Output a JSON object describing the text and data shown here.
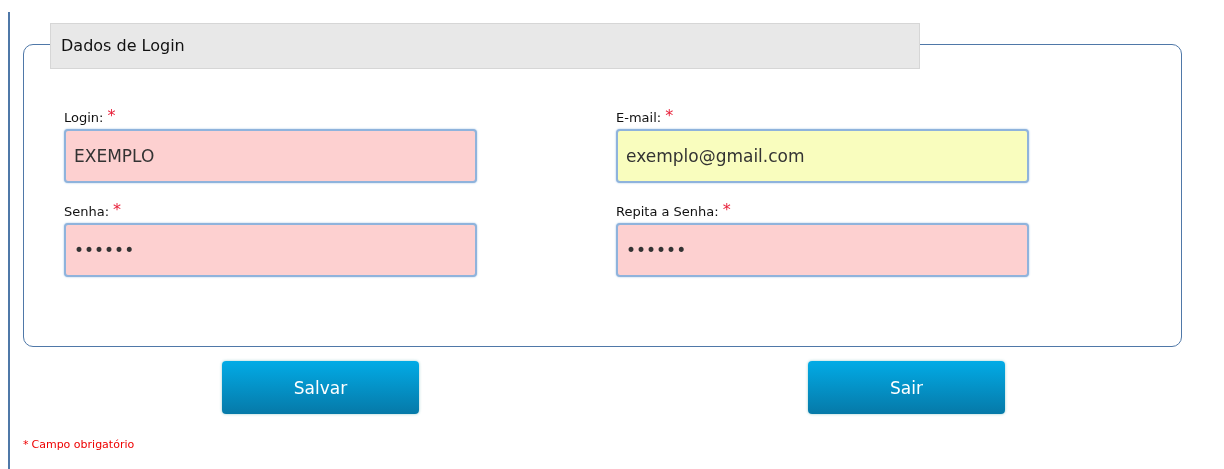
{
  "fieldset": {
    "legend": "Dados de Login",
    "fields": [
      {
        "label": "Login:",
        "required_mark": "*",
        "value": "EXEMPLO",
        "color": "#fdd0d0"
      },
      {
        "label": "E-mail:",
        "required_mark": "*",
        "value": "exemplo@gmail.com",
        "color": "#f9fdbe"
      },
      {
        "label": "Senha:",
        "required_mark": "*",
        "value": "••••••",
        "color": "#fdd0d0"
      },
      {
        "label": "Repita a Senha:",
        "required_mark": "*",
        "value": "••••••",
        "color": "#fdd0d0"
      }
    ]
  },
  "buttons": [
    "Salvar",
    "Sair"
  ],
  "footnote": {
    "mark": "*",
    "text": "Campo obrigatório"
  }
}
